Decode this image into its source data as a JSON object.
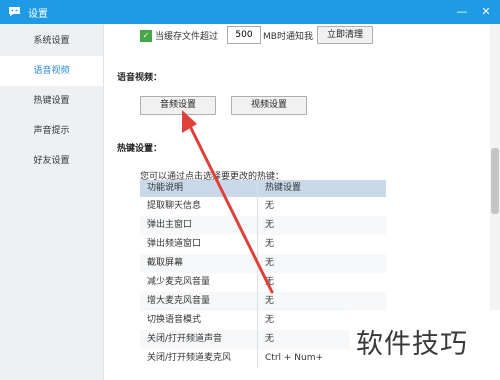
{
  "window": {
    "title": "设置",
    "controls": {
      "minimize": "—",
      "close": "✕"
    }
  },
  "sidebar": {
    "items": [
      {
        "label": "系统设置"
      },
      {
        "label": "语音视频"
      },
      {
        "label": "热键设置"
      },
      {
        "label": "声音提示"
      },
      {
        "label": "好友设置"
      }
    ],
    "active": "语音视频"
  },
  "cache": {
    "checked": true,
    "label_before": "当缓存文件超过",
    "value": "500",
    "label_after": "MB时通知我",
    "clear_button": "立即清理"
  },
  "voice_video": {
    "section_title": "语音视频：",
    "audio_button": "音频设置",
    "video_button": "视频设置"
  },
  "hotkeys": {
    "section_title": "热键设置：",
    "hint": "您可以通过点击选择要更改的热键：",
    "headers": {
      "function": "功能说明",
      "key": "热键设置"
    },
    "rows": [
      {
        "function": "提取聊天信息",
        "key": "无"
      },
      {
        "function": "弹出主窗口",
        "key": "无"
      },
      {
        "function": "弹出频道窗口",
        "key": "无"
      },
      {
        "function": "截取屏幕",
        "key": "无"
      },
      {
        "function": "减少麦克风音量",
        "key": "无"
      },
      {
        "function": "增大麦克风音量",
        "key": "无"
      },
      {
        "function": "切换语音模式",
        "key": "无"
      },
      {
        "function": "关闭/打开频道声音",
        "key": "无"
      },
      {
        "function": "关闭/打开频道麦克风",
        "key": "Ctrl + Num+"
      }
    ]
  },
  "watermark": {
    "text": "软件技巧"
  },
  "colors": {
    "titlebar": "#1f9be6",
    "active_text": "#2a8ad8",
    "arrow": "#e0403a",
    "checkbox": "#46a948",
    "table_header": "#c9d9ea"
  },
  "icons": {
    "app_logo": "chat-logo-icon",
    "checkbox": "checkmark-icon"
  }
}
